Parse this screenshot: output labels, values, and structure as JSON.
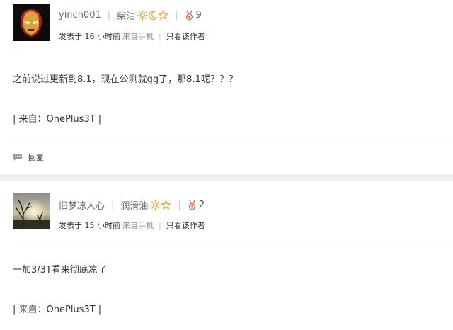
{
  "posts": [
    {
      "username": "yinch001",
      "level": "柴油",
      "medal_count": "9",
      "posted": "发表于 16 小时前",
      "source": "来自手机",
      "only_author": "只看该作者",
      "content": "之前说过更新到8.1，现在公测就gg了，那8.1呢？？？",
      "from": "| 来自：OnePlus3T |",
      "reply_label": "回复"
    },
    {
      "username": "旧梦凉人心",
      "level": "润滑油",
      "medal_count": "2",
      "posted": "发表于 15 小时前",
      "source": "来自手机",
      "only_author": "只看该作者",
      "content": "一加3/3T看来彻底凉了",
      "from": "| 来自：OnePlus3T |"
    }
  ],
  "icons": {
    "sun": "sun-icon",
    "moon": "moon-icon",
    "star": "star-icon",
    "medal": "medal-icon",
    "reply": "reply-icon"
  },
  "colors": {
    "level_icon": "#f0a020",
    "medal": "#e06a4f",
    "separator": "#efefef"
  }
}
